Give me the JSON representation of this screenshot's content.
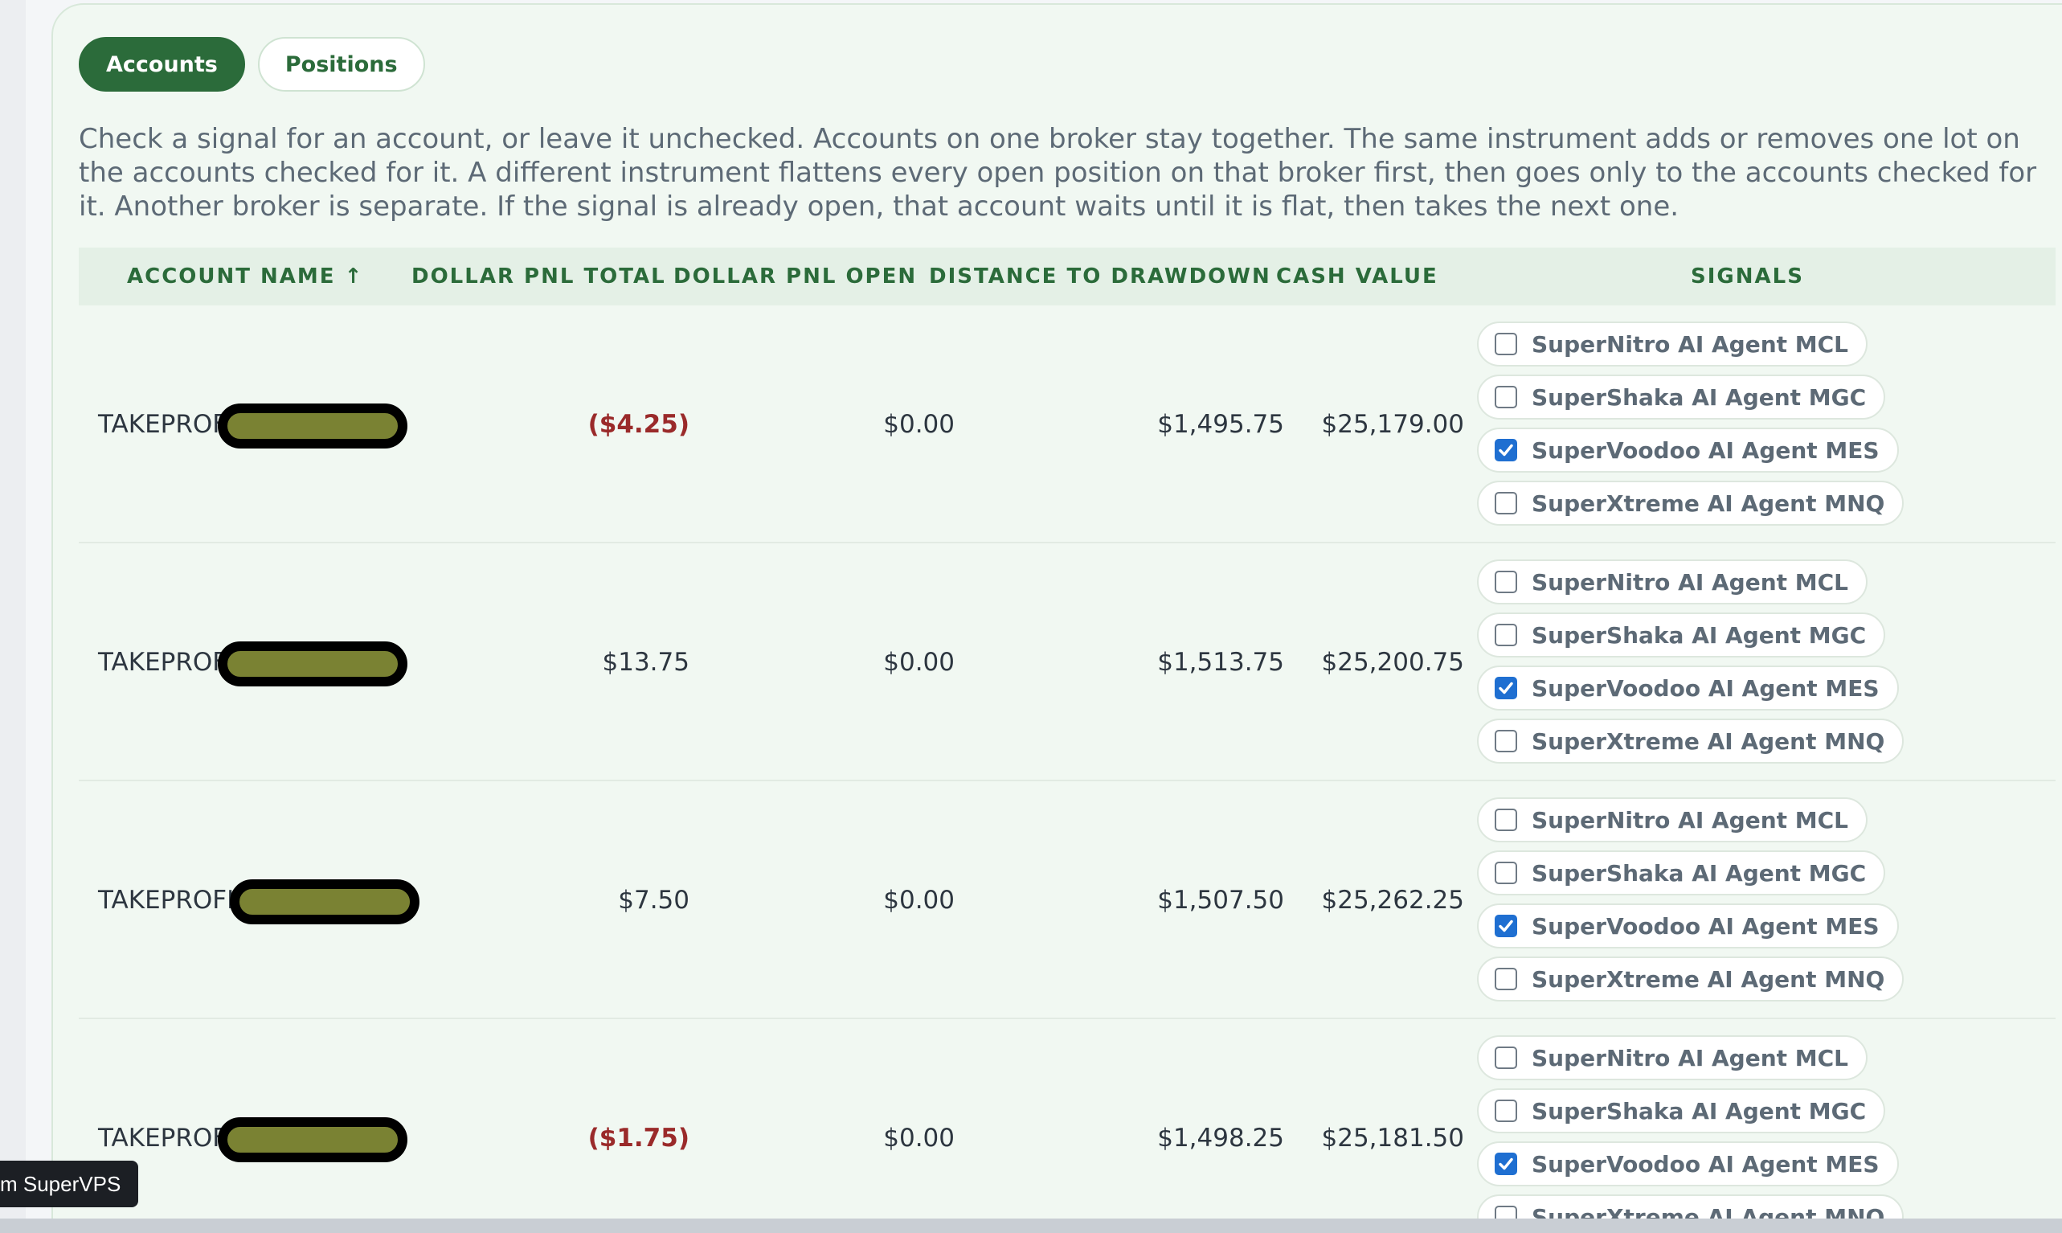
{
  "tabs": [
    {
      "label": "Accounts",
      "active": true
    },
    {
      "label": "Positions",
      "active": false
    }
  ],
  "info_text": "Check a signal for an account, or leave it unchecked. Accounts on one broker stay together. The same instrument adds or removes one lot on the accounts checked for it. A different instrument flattens every open position on that broker first, then goes only to the accounts checked for it. Another broker is separate. If the signal is already open, that account waits until it is flat, then takes the next one.",
  "table": {
    "columns": [
      "ACCOUNT NAME ↑",
      "DOLLAR PNL TOTAL",
      "DOLLAR PNL OPEN",
      "DISTANCE TO DRAWDOWN",
      "CASH VALUE",
      "SIGNALS"
    ],
    "rows": [
      {
        "account": "TAKEPROF",
        "pnl_total": "($4.25)",
        "pnl_total_negative": true,
        "pnl_open": "$0.00",
        "distance": "$1,495.75",
        "cash": "$25,179.00",
        "signals": [
          {
            "label": "SuperNitro AI Agent MCL",
            "checked": false
          },
          {
            "label": "SuperShaka AI Agent MGC",
            "checked": false
          },
          {
            "label": "SuperVoodoo AI Agent MES",
            "checked": true
          },
          {
            "label": "SuperXtreme AI Agent MNQ",
            "checked": false
          }
        ]
      },
      {
        "account": "TAKEPROF",
        "pnl_total": "$13.75",
        "pnl_total_negative": false,
        "pnl_open": "$0.00",
        "distance": "$1,513.75",
        "cash": "$25,200.75",
        "signals": [
          {
            "label": "SuperNitro AI Agent MCL",
            "checked": false
          },
          {
            "label": "SuperShaka AI Agent MGC",
            "checked": false
          },
          {
            "label": "SuperVoodoo AI Agent MES",
            "checked": true
          },
          {
            "label": "SuperXtreme AI Agent MNQ",
            "checked": false
          }
        ]
      },
      {
        "account": "TAKEPROFI",
        "pnl_total": "$7.50",
        "pnl_total_negative": false,
        "pnl_open": "$0.00",
        "distance": "$1,507.50",
        "cash": "$25,262.25",
        "signals": [
          {
            "label": "SuperNitro AI Agent MCL",
            "checked": false
          },
          {
            "label": "SuperShaka AI Agent MGC",
            "checked": false
          },
          {
            "label": "SuperVoodoo AI Agent MES",
            "checked": true
          },
          {
            "label": "SuperXtreme AI Agent MNQ",
            "checked": false
          }
        ]
      },
      {
        "account": "TAKEPROF",
        "pnl_total": "($1.75)",
        "pnl_total_negative": true,
        "pnl_open": "$0.00",
        "distance": "$1,498.25",
        "cash": "$25,181.50",
        "signals": [
          {
            "label": "SuperNitro AI Agent MCL",
            "checked": false
          },
          {
            "label": "SuperShaka AI Agent MGC",
            "checked": false
          },
          {
            "label": "SuperVoodoo AI Agent MES",
            "checked": true
          },
          {
            "label": "SuperXtreme AI Agent MNQ",
            "checked": false
          }
        ]
      }
    ]
  },
  "tooltip": "m SuperVPS",
  "colors": {
    "accent": "#2b6b3a",
    "negative": "#9a2a2a",
    "checkbox_checked": "#1f6fd1",
    "redaction": "#7a8233"
  }
}
